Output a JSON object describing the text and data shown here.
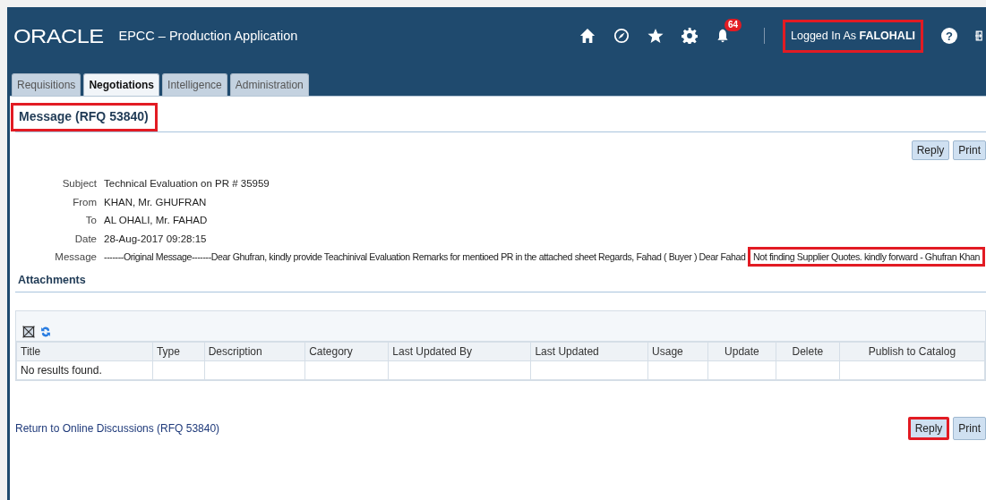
{
  "header": {
    "logo": "ORACLE",
    "app_title": "EPCC – Production Application",
    "notification_count": "64",
    "user_label": "Logged In As",
    "user_name": "FALOHALI",
    "user_highlighted": true,
    "help": "?"
  },
  "tabs": [
    {
      "label": "Requisitions",
      "selected": false
    },
    {
      "label": "Negotiations",
      "selected": true
    },
    {
      "label": "Intelligence",
      "selected": false
    },
    {
      "label": "Administration",
      "selected": false
    }
  ],
  "page_title": {
    "text": "Message (RFQ 53840)",
    "highlighted": true
  },
  "top_buttons": [
    {
      "label": "Reply",
      "highlighted": false
    },
    {
      "label": "Print",
      "highlighted": false
    }
  ],
  "fields": [
    {
      "label": "Subject",
      "value": "Technical Evaluation on PR # 35959"
    },
    {
      "label": "From",
      "value": "KHAN, Mr. GHUFRAN"
    },
    {
      "label": "To",
      "value": "AL OHALI, Mr. FAHAD"
    },
    {
      "label": "Date",
      "value": "28-Aug-2017 09:28:15"
    }
  ],
  "message": {
    "label": "Message",
    "parts": [
      {
        "text": "-------Original Message-------Dear Ghufran, kindly provide Teachinival Evaluation Remarks for mentioed PR in the attached sheet Regards, Fahad ( Buyer ) Dear Fahad",
        "highlighted": false
      },
      {
        "text": "Not finding Supplier Quotes. kindly forward - Ghufran Khan",
        "highlighted": true
      }
    ]
  },
  "attachments": {
    "title": "Attachments",
    "columns": [
      "Title",
      "Type",
      "Description",
      "Category",
      "Last Updated By",
      "Last Updated",
      "Usage",
      "Update",
      "Delete",
      "Publish to Catalog"
    ],
    "empty_text": "No results found."
  },
  "return_link": "Return to Online Discussions (RFQ 53840)",
  "bottom_buttons": [
    {
      "label": "Reply",
      "highlighted": true
    },
    {
      "label": "Print",
      "highlighted": false
    }
  ]
}
